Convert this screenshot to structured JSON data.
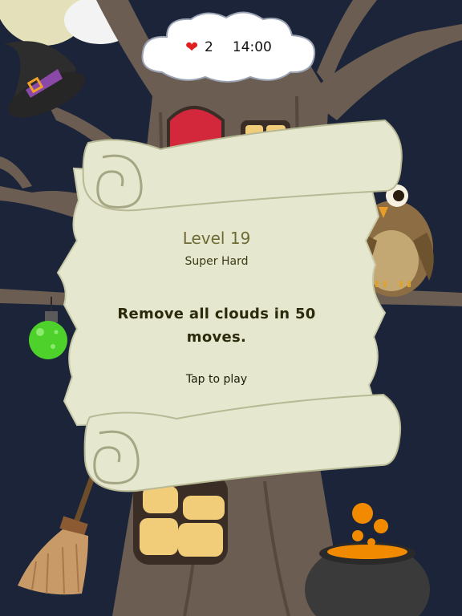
{
  "hud": {
    "lives_icon": "heart-icon",
    "lives": "2",
    "timer": "14:00"
  },
  "level": {
    "title": "Level 19",
    "difficulty": "Super Hard",
    "objective": "Remove all clouds in 50 moves.",
    "tap_prompt": "Tap to play"
  },
  "colors": {
    "background": "#1b2438",
    "tree": "#6b5d52",
    "scroll": "#e6e7cf",
    "heart": "#e02020",
    "potion": "#4ed12a",
    "orange": "#f28a00"
  }
}
